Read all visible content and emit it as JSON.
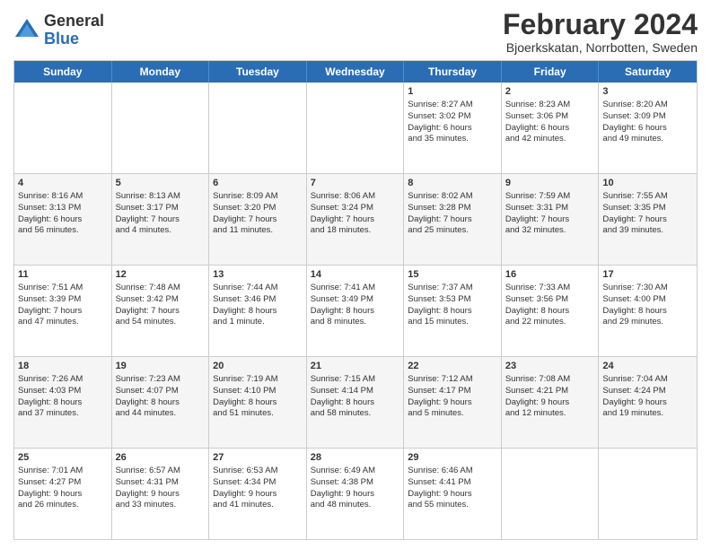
{
  "header": {
    "logo_general": "General",
    "logo_blue": "Blue",
    "title": "February 2024",
    "subtitle": "Bjoerkskatan, Norrbotten, Sweden"
  },
  "weekdays": [
    "Sunday",
    "Monday",
    "Tuesday",
    "Wednesday",
    "Thursday",
    "Friday",
    "Saturday"
  ],
  "rows": [
    [
      {
        "day": "",
        "lines": []
      },
      {
        "day": "",
        "lines": []
      },
      {
        "day": "",
        "lines": []
      },
      {
        "day": "",
        "lines": []
      },
      {
        "day": "1",
        "lines": [
          "Sunrise: 8:27 AM",
          "Sunset: 3:02 PM",
          "Daylight: 6 hours",
          "and 35 minutes."
        ]
      },
      {
        "day": "2",
        "lines": [
          "Sunrise: 8:23 AM",
          "Sunset: 3:06 PM",
          "Daylight: 6 hours",
          "and 42 minutes."
        ]
      },
      {
        "day": "3",
        "lines": [
          "Sunrise: 8:20 AM",
          "Sunset: 3:09 PM",
          "Daylight: 6 hours",
          "and 49 minutes."
        ]
      }
    ],
    [
      {
        "day": "4",
        "lines": [
          "Sunrise: 8:16 AM",
          "Sunset: 3:13 PM",
          "Daylight: 6 hours",
          "and 56 minutes."
        ]
      },
      {
        "day": "5",
        "lines": [
          "Sunrise: 8:13 AM",
          "Sunset: 3:17 PM",
          "Daylight: 7 hours",
          "and 4 minutes."
        ]
      },
      {
        "day": "6",
        "lines": [
          "Sunrise: 8:09 AM",
          "Sunset: 3:20 PM",
          "Daylight: 7 hours",
          "and 11 minutes."
        ]
      },
      {
        "day": "7",
        "lines": [
          "Sunrise: 8:06 AM",
          "Sunset: 3:24 PM",
          "Daylight: 7 hours",
          "and 18 minutes."
        ]
      },
      {
        "day": "8",
        "lines": [
          "Sunrise: 8:02 AM",
          "Sunset: 3:28 PM",
          "Daylight: 7 hours",
          "and 25 minutes."
        ]
      },
      {
        "day": "9",
        "lines": [
          "Sunrise: 7:59 AM",
          "Sunset: 3:31 PM",
          "Daylight: 7 hours",
          "and 32 minutes."
        ]
      },
      {
        "day": "10",
        "lines": [
          "Sunrise: 7:55 AM",
          "Sunset: 3:35 PM",
          "Daylight: 7 hours",
          "and 39 minutes."
        ]
      }
    ],
    [
      {
        "day": "11",
        "lines": [
          "Sunrise: 7:51 AM",
          "Sunset: 3:39 PM",
          "Daylight: 7 hours",
          "and 47 minutes."
        ]
      },
      {
        "day": "12",
        "lines": [
          "Sunrise: 7:48 AM",
          "Sunset: 3:42 PM",
          "Daylight: 7 hours",
          "and 54 minutes."
        ]
      },
      {
        "day": "13",
        "lines": [
          "Sunrise: 7:44 AM",
          "Sunset: 3:46 PM",
          "Daylight: 8 hours",
          "and 1 minute."
        ]
      },
      {
        "day": "14",
        "lines": [
          "Sunrise: 7:41 AM",
          "Sunset: 3:49 PM",
          "Daylight: 8 hours",
          "and 8 minutes."
        ]
      },
      {
        "day": "15",
        "lines": [
          "Sunrise: 7:37 AM",
          "Sunset: 3:53 PM",
          "Daylight: 8 hours",
          "and 15 minutes."
        ]
      },
      {
        "day": "16",
        "lines": [
          "Sunrise: 7:33 AM",
          "Sunset: 3:56 PM",
          "Daylight: 8 hours",
          "and 22 minutes."
        ]
      },
      {
        "day": "17",
        "lines": [
          "Sunrise: 7:30 AM",
          "Sunset: 4:00 PM",
          "Daylight: 8 hours",
          "and 29 minutes."
        ]
      }
    ],
    [
      {
        "day": "18",
        "lines": [
          "Sunrise: 7:26 AM",
          "Sunset: 4:03 PM",
          "Daylight: 8 hours",
          "and 37 minutes."
        ]
      },
      {
        "day": "19",
        "lines": [
          "Sunrise: 7:23 AM",
          "Sunset: 4:07 PM",
          "Daylight: 8 hours",
          "and 44 minutes."
        ]
      },
      {
        "day": "20",
        "lines": [
          "Sunrise: 7:19 AM",
          "Sunset: 4:10 PM",
          "Daylight: 8 hours",
          "and 51 minutes."
        ]
      },
      {
        "day": "21",
        "lines": [
          "Sunrise: 7:15 AM",
          "Sunset: 4:14 PM",
          "Daylight: 8 hours",
          "and 58 minutes."
        ]
      },
      {
        "day": "22",
        "lines": [
          "Sunrise: 7:12 AM",
          "Sunset: 4:17 PM",
          "Daylight: 9 hours",
          "and 5 minutes."
        ]
      },
      {
        "day": "23",
        "lines": [
          "Sunrise: 7:08 AM",
          "Sunset: 4:21 PM",
          "Daylight: 9 hours",
          "and 12 minutes."
        ]
      },
      {
        "day": "24",
        "lines": [
          "Sunrise: 7:04 AM",
          "Sunset: 4:24 PM",
          "Daylight: 9 hours",
          "and 19 minutes."
        ]
      }
    ],
    [
      {
        "day": "25",
        "lines": [
          "Sunrise: 7:01 AM",
          "Sunset: 4:27 PM",
          "Daylight: 9 hours",
          "and 26 minutes."
        ]
      },
      {
        "day": "26",
        "lines": [
          "Sunrise: 6:57 AM",
          "Sunset: 4:31 PM",
          "Daylight: 9 hours",
          "and 33 minutes."
        ]
      },
      {
        "day": "27",
        "lines": [
          "Sunrise: 6:53 AM",
          "Sunset: 4:34 PM",
          "Daylight: 9 hours",
          "and 41 minutes."
        ]
      },
      {
        "day": "28",
        "lines": [
          "Sunrise: 6:49 AM",
          "Sunset: 4:38 PM",
          "Daylight: 9 hours",
          "and 48 minutes."
        ]
      },
      {
        "day": "29",
        "lines": [
          "Sunrise: 6:46 AM",
          "Sunset: 4:41 PM",
          "Daylight: 9 hours",
          "and 55 minutes."
        ]
      },
      {
        "day": "",
        "lines": []
      },
      {
        "day": "",
        "lines": []
      }
    ]
  ]
}
